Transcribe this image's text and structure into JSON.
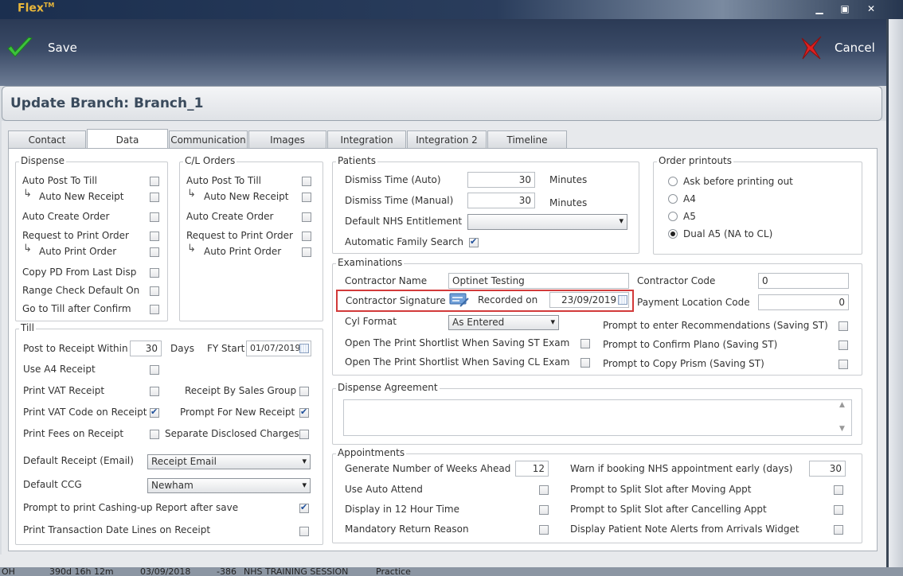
{
  "app": {
    "title": "Flex",
    "tm": "TM"
  },
  "toolbar": {
    "save_label": "Save",
    "cancel_label": "Cancel"
  },
  "header": {
    "title": "Update Branch: Branch_1"
  },
  "tabs": [
    "Contact",
    "Data",
    "Communication",
    "Images",
    "Integration",
    "Integration 2",
    "Timeline"
  ],
  "active_tab": "Data",
  "dispense": {
    "legend": "Dispense",
    "items": [
      {
        "label": "Auto Post To Till",
        "checked": false,
        "sub": false
      },
      {
        "label": "Auto New Receipt",
        "checked": false,
        "sub": true
      },
      {
        "label": "Auto Create Order",
        "checked": false,
        "sub": false
      },
      {
        "label": "Request to Print Order",
        "checked": false,
        "sub": false
      },
      {
        "label": "Auto Print Order",
        "checked": false,
        "sub": true
      },
      {
        "label": "Copy PD From Last Disp",
        "checked": false,
        "sub": false
      },
      {
        "label": "Range Check Default On",
        "checked": false,
        "sub": false
      },
      {
        "label": "Go to Till after Confirm",
        "checked": false,
        "sub": false
      }
    ]
  },
  "cl_orders": {
    "legend": "C/L Orders",
    "items": [
      {
        "label": "Auto Post To Till",
        "checked": false,
        "sub": false
      },
      {
        "label": "Auto New Receipt",
        "checked": false,
        "sub": true
      },
      {
        "label": "Auto Create Order",
        "checked": false,
        "sub": false
      },
      {
        "label": "Request to Print Order",
        "checked": false,
        "sub": false
      },
      {
        "label": "Auto Print Order",
        "checked": false,
        "sub": true
      }
    ]
  },
  "till": {
    "legend": "Till",
    "post_to_receipt_label": "Post to Receipt Within",
    "post_to_receipt_value": "30",
    "days_label": "Days",
    "fy_start_label": "FY Start",
    "fy_start_value": "01/07/2019",
    "use_a4_label": "Use A4 Receipt",
    "print_vat_label": "Print VAT Receipt",
    "receipt_by_sales_group_label": "Receipt By Sales Group",
    "print_vat_code_label": "Print VAT Code on Receipt",
    "prompt_new_receipt_label": "Prompt For New Receipt",
    "print_fees_label": "Print Fees on Receipt",
    "separate_disclosed_label": "Separate Disclosed Charges",
    "default_receipt_label": "Default Receipt (Email)",
    "default_receipt_value": "Receipt Email",
    "default_ccg_label": "Default CCG",
    "default_ccg_value": "Newham",
    "prompt_cashing_label": "Prompt to print Cashing-up Report after save",
    "print_transaction_label": "Print Transaction Date Lines on Receipt",
    "checks": {
      "use_a4": false,
      "print_vat": false,
      "receipt_by_sales_group": false,
      "print_vat_code": true,
      "prompt_new_receipt": true,
      "print_fees": false,
      "separate_disclosed": false,
      "prompt_cashing": true,
      "print_transaction": false
    }
  },
  "patients": {
    "legend": "Patients",
    "dismiss_auto_label": "Dismiss Time (Auto)",
    "dismiss_auto_value": "30",
    "dismiss_manual_label": "Dismiss Time (Manual)",
    "dismiss_manual_value": "30",
    "minutes_label": "Minutes",
    "nhs_entitlement_label": "Default NHS Entitlement",
    "nhs_entitlement_value": "",
    "family_search_label": "Automatic Family Search",
    "family_search_checked": true
  },
  "order_printouts": {
    "legend": "Order printouts",
    "options": [
      {
        "label": "Ask before printing out",
        "selected": false
      },
      {
        "label": "A4",
        "selected": false
      },
      {
        "label": "A5",
        "selected": false
      },
      {
        "label": "Dual A5 (NA to CL)",
        "selected": true
      }
    ]
  },
  "examinations": {
    "legend": "Examinations",
    "contractor_name_label": "Contractor Name",
    "contractor_name_value": "Optinet Testing",
    "contractor_code_label": "Contractor Code",
    "contractor_code_value": "0",
    "contractor_signature_label": "Contractor Signature",
    "recorded_on_label": "Recorded on",
    "recorded_on_value": "23/09/2019",
    "payment_location_label": "Payment Location Code",
    "payment_location_value": "0",
    "cyl_format_label": "Cyl Format",
    "cyl_format_value": "As Entered",
    "shortlist_st_label": "Open The Print Shortlist When Saving ST Exam",
    "shortlist_cl_label": "Open The Print Shortlist When Saving CL Exam",
    "prompt_recommendations_label": "Prompt to enter Recommendations (Saving ST)",
    "prompt_plano_label": "Prompt to Confirm Plano (Saving ST)",
    "prompt_prism_label": "Prompt to Copy Prism (Saving ST)"
  },
  "dispense_agreement": {
    "legend": "Dispense Agreement",
    "text": ""
  },
  "appointments": {
    "legend": "Appointments",
    "weeks_ahead_label": "Generate Number of Weeks Ahead",
    "weeks_ahead_value": "12",
    "warn_nhs_label": "Warn if booking NHS appointment early (days)",
    "warn_nhs_value": "30",
    "use_auto_attend_label": "Use Auto Attend",
    "split_moving_label": "Prompt to Split Slot after Moving Appt",
    "display_12h_label": "Display in 12 Hour Time",
    "split_cancelling_label": "Prompt to Split Slot after Cancelling Appt",
    "mandatory_return_label": "Mandatory Return Reason",
    "patient_note_alerts_label": "Display Patient Note Alerts from Arrivals Widget"
  },
  "statusbar": {
    "a": "OH",
    "b": "390d 16h 12m",
    "c": "03/09/2018",
    "d": "-386",
    "e": "NHS TRAINING SESSION",
    "f": "Practice"
  },
  "colors": {
    "accent_red": "#d23a3a",
    "title_gold": "#e9b73a",
    "toolbar_navy": "#2b3a55"
  }
}
